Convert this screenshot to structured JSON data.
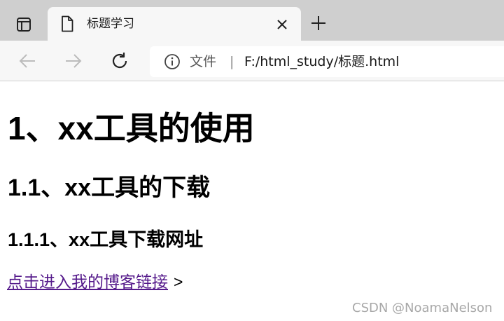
{
  "browser": {
    "tab": {
      "title": "标题学习",
      "close_label": "×",
      "new_tab_label": "+"
    },
    "addressbar": {
      "scheme_label": "文件",
      "separator": "|",
      "url": "F:/html_study/标题.html"
    },
    "icons": {
      "tab_actions": "tab-actions-icon",
      "document": "document-icon",
      "back": "back-arrow-icon",
      "forward": "forward-arrow-icon",
      "reload": "reload-icon",
      "info": "info-icon"
    }
  },
  "page": {
    "h1": "1、xx工具的使用",
    "h2": "1.1、xx工具的下载",
    "h3": "1.1.1、xx工具下载网址",
    "link_text": "点击进入我的博客链接",
    "link_suffix": ">",
    "watermark": "CSDN @NoamaNelson"
  },
  "colors": {
    "tabstrip_bg": "#cfcfcf",
    "toolbar_bg": "#f7f7f7",
    "visited_link": "#551a8b",
    "watermark": "#a8a8a8"
  }
}
